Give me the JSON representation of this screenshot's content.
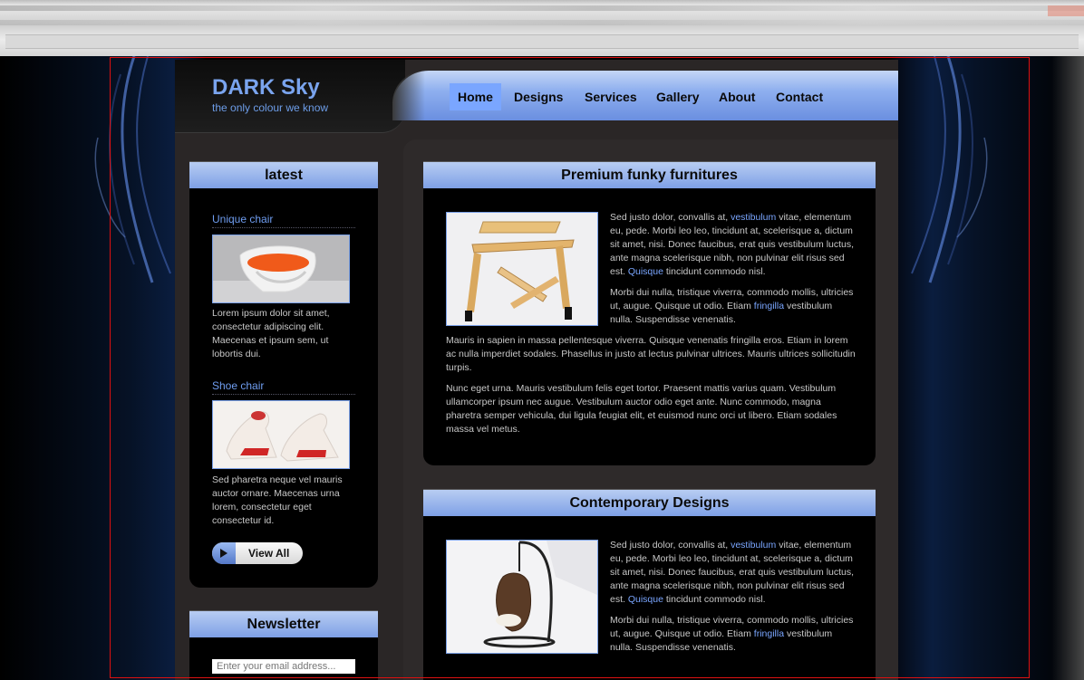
{
  "site": {
    "title": "DARK Sky",
    "tagline": "the only colour we know"
  },
  "nav": [
    {
      "label": "Home",
      "active": true
    },
    {
      "label": "Designs",
      "active": false
    },
    {
      "label": "Services",
      "active": false
    },
    {
      "label": "Gallery",
      "active": false
    },
    {
      "label": "About",
      "active": false
    },
    {
      "label": "Contact",
      "active": false
    }
  ],
  "sidebar": {
    "heading": "latest",
    "items": [
      {
        "title": "Unique chair",
        "text": "Lorem ipsum dolor sit amet, consectetur adipiscing elit. Maecenas et ipsum sem, ut lobortis dui."
      },
      {
        "title": "Shoe chair",
        "text": "Sed pharetra neque vel mauris auctor ornare. Maecenas urna lorem, consectetur eget consectetur id."
      }
    ],
    "view_all_label": "View All"
  },
  "newsletter": {
    "heading": "Newsletter",
    "email_placeholder": "Enter your email address..."
  },
  "articles": [
    {
      "heading": "Premium funky furnitures",
      "p1_a": "Sed justo dolor, convallis at, ",
      "p1_link1": "vestibulum",
      "p1_b": " vitae, elementum eu, pede. Morbi leo leo, tincidunt at, scelerisque a, dictum sit amet, nisi. Donec faucibus, erat quis vestibulum luctus, ante magna scelerisque nibh, non pulvinar elit risus sed est. ",
      "p1_link2": "Quisque",
      "p1_c": " tincidunt commodo nisl.",
      "p2_a": "Morbi dui nulla, tristique viverra, commodo mollis, ultricies ut, augue. Quisque ut odio. Etiam ",
      "p2_link": "fringilla",
      "p2_b": " vestibulum nulla. Suspendisse venenatis.",
      "p3": "Mauris in sapien in massa pellentesque viverra. Quisque venenatis fringilla eros. Etiam in lorem ac nulla imperdiet sodales. Phasellus in justo at lectus pulvinar ultrices. Mauris ultrices sollicitudin turpis.",
      "p4": "Nunc eget urna. Mauris vestibulum felis eget tortor. Praesent mattis varius quam. Vestibulum ullamcorper ipsum nec augue. Vestibulum auctor odio eget ante. Nunc commodo, magna pharetra semper vehicula, dui ligula feugiat elit, et euismod nunc orci ut libero. Etiam sodales massa vel metus."
    },
    {
      "heading": "Contemporary Designs",
      "p1_a": "Sed justo dolor, convallis at, ",
      "p1_link1": "vestibulum",
      "p1_b": " vitae, elementum eu, pede. Morbi leo leo, tincidunt at, scelerisque a, dictum sit amet, nisi. Donec faucibus, erat quis vestibulum luctus, ante magna scelerisque nibh, non pulvinar elit risus sed est. ",
      "p1_link2": "Quisque",
      "p1_c": " tincidunt commodo nisl.",
      "p2_a": "Morbi dui nulla, tristique viverra, commodo mollis, ultricies ut, augue. Quisque ut odio. Etiam ",
      "p2_link": "fringilla",
      "p2_b": " vestibulum nulla. Suspendisse venenatis."
    }
  ],
  "colors": {
    "accent": "#7aa6ff",
    "nav_active": "#7aa6ff",
    "frame_red": "#dd1111"
  }
}
